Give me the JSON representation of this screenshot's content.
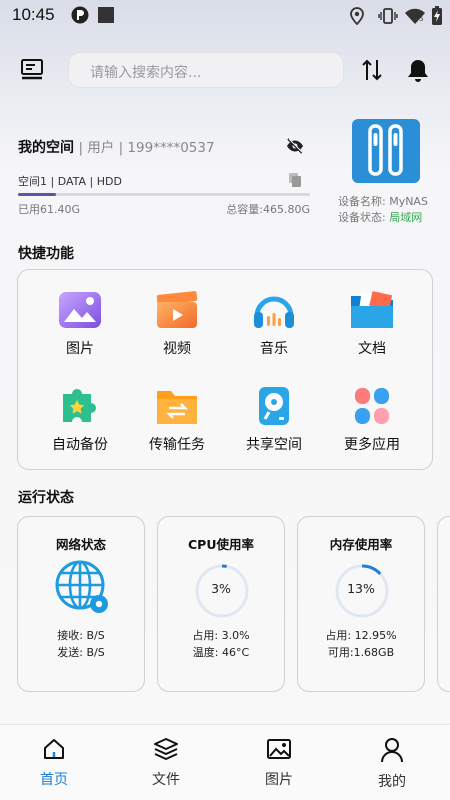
{
  "status_bar": {
    "time": "10:45",
    "battery_badge": "5"
  },
  "header": {
    "menu_icon": "menu-list-icon",
    "search_placeholder": "请输入搜索内容...",
    "transfer_icon": "up-down-arrows-icon",
    "bell_icon": "bell-icon"
  },
  "space": {
    "title": "我的空间",
    "user_label": "| 用户 | 199****0537",
    "volume": "空间1 | DATA | HDD",
    "used": "已用61.40G",
    "total": "总容量:465.80G",
    "usage_fraction": 0.13
  },
  "device": {
    "name_label": "设备名称: MyNAS",
    "status_label": "设备状态: ",
    "status_value": "局域网",
    "status_color": "#34a853"
  },
  "quick": {
    "title": "快捷功能",
    "items": [
      {
        "label": "图片",
        "icon": "photo-gallery-icon"
      },
      {
        "label": "视频",
        "icon": "video-clapper-icon"
      },
      {
        "label": "音乐",
        "icon": "headphones-icon"
      },
      {
        "label": "文档",
        "icon": "folder-documents-icon"
      },
      {
        "label": "自动备份",
        "icon": "puzzle-backup-icon"
      },
      {
        "label": "传输任务",
        "icon": "transfer-folder-icon"
      },
      {
        "label": "共享空间",
        "icon": "shared-disk-icon"
      },
      {
        "label": "更多应用",
        "icon": "more-apps-grid-icon"
      }
    ]
  },
  "run_status": {
    "title": "运行状态",
    "network": {
      "title": "网络状态",
      "recv": "接收: B/S",
      "send": "发送: B/S"
    },
    "cpu": {
      "title": "CPU使用率",
      "percent_label": "3%",
      "percent": 3,
      "usage": "占用: 3.0%",
      "temp": "温度: 46°C"
    },
    "memory": {
      "title": "内存使用率",
      "percent_label": "13%",
      "percent": 13,
      "usage": "占用: 12.95%",
      "available": "可用:1.68GB"
    },
    "ring_color": "#1d7ed8"
  },
  "nav": [
    {
      "label": "首页",
      "icon": "home-icon"
    },
    {
      "label": "文件",
      "icon": "files-stack-icon"
    },
    {
      "label": "图片",
      "icon": "image-icon"
    },
    {
      "label": "我的",
      "icon": "user-profile-icon"
    }
  ]
}
